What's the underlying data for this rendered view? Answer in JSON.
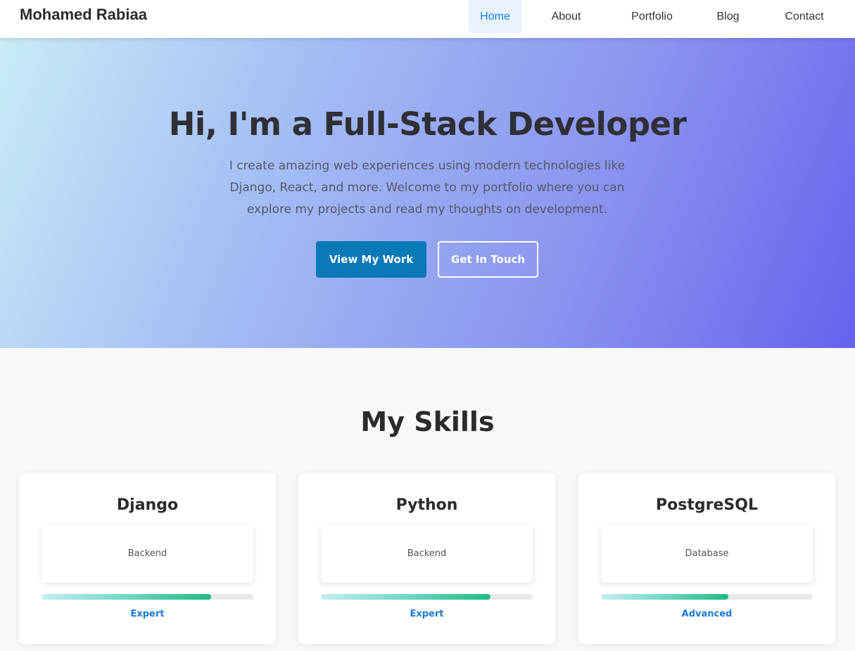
{
  "nav": {
    "brand": "Mohamed Rabiaa",
    "links": [
      {
        "label": "Home",
        "active": true
      },
      {
        "label": "About",
        "active": false
      },
      {
        "label": "Portfolio",
        "active": false
      },
      {
        "label": "Blog",
        "active": false
      },
      {
        "label": "Contact",
        "active": false
      }
    ]
  },
  "hero": {
    "title": "Hi, I'm a Full-Stack Developer",
    "subtitle": "I create amazing web experiences using modern technologies like Django, React, and more. Welcome to my portfolio where you can explore my projects and read my thoughts on development.",
    "primary_button": "View My Work",
    "secondary_button": "Get In Touch"
  },
  "skills": {
    "title": "My Skills",
    "items": [
      {
        "name": "Django",
        "category": "Backend",
        "level": "Expert",
        "progress": 0.8
      },
      {
        "name": "Python",
        "category": "Backend",
        "level": "Expert",
        "progress": 0.8
      },
      {
        "name": "PostgreSQL",
        "category": "Database",
        "level": "Advanced",
        "progress": 0.6
      }
    ]
  },
  "colors": {
    "accent": "#1b7bd4",
    "primary_button": "#0a79b8",
    "progress_end": "#1fba84"
  }
}
